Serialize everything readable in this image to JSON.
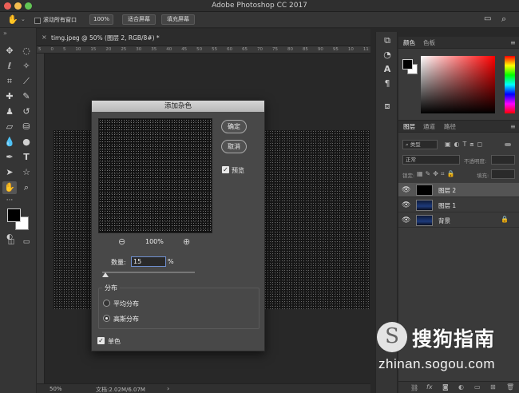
{
  "app": {
    "title": "Adobe Photoshop CC 2017"
  },
  "colors": {
    "accent_input_border": "#6f8fcf",
    "close": "#ec5f57",
    "minimize": "#f4bd4f",
    "zoom": "#62c454"
  },
  "options_bar": {
    "hand_icon": "hand-icon",
    "scroll_all_label": "滚动所有窗口",
    "zoom_btn": "100%",
    "fit_screen_btn": "适合屏幕",
    "fill_screen_btn": "填充屏幕"
  },
  "document": {
    "tab_title": "timg.jpeg @ 50% (图层 2, RGB/8#) *",
    "ruler_marks": [
      "5",
      "0",
      "5",
      "10",
      "15",
      "20",
      "25",
      "30",
      "35",
      "40",
      "45",
      "50",
      "55",
      "60",
      "65",
      "70",
      "75",
      "80",
      "85",
      "90",
      "95",
      "10",
      "11"
    ],
    "zoom": "50%",
    "doc_size": "文档:2.02M/6.07M"
  },
  "dialog": {
    "title": "添加杂色",
    "ok_label": "确定",
    "cancel_label": "取消",
    "preview_label": "预览",
    "zoom_level": "100%",
    "amount_label": "数量:",
    "amount_value": "15",
    "amount_unit": "%",
    "amount_percent": 15,
    "distribution_label": "分布",
    "uniform_label": "平均分布",
    "gaussian_label": "高斯分布",
    "distribution_selected": "高斯分布",
    "mono_label": "单色"
  },
  "color_panel": {
    "tab_color": "颜色",
    "tab_swatches": "色板"
  },
  "layers_panel": {
    "tab_layers": "图层",
    "tab_channels": "通道",
    "tab_paths": "路径",
    "filter_kind": "类型",
    "blend_mode": "正常",
    "opacity_label": "不透明度:",
    "lock_label": "锁定:",
    "fill_label": "填充:",
    "layers": [
      {
        "name": "图层 2",
        "selected": true
      },
      {
        "name": "图层 1",
        "selected": false
      },
      {
        "name": "背景",
        "selected": false,
        "locked": true
      }
    ]
  },
  "watermark": {
    "brand": "搜狗指南",
    "url": "zhinan.sogou.com",
    "logo_glyph": "S"
  }
}
